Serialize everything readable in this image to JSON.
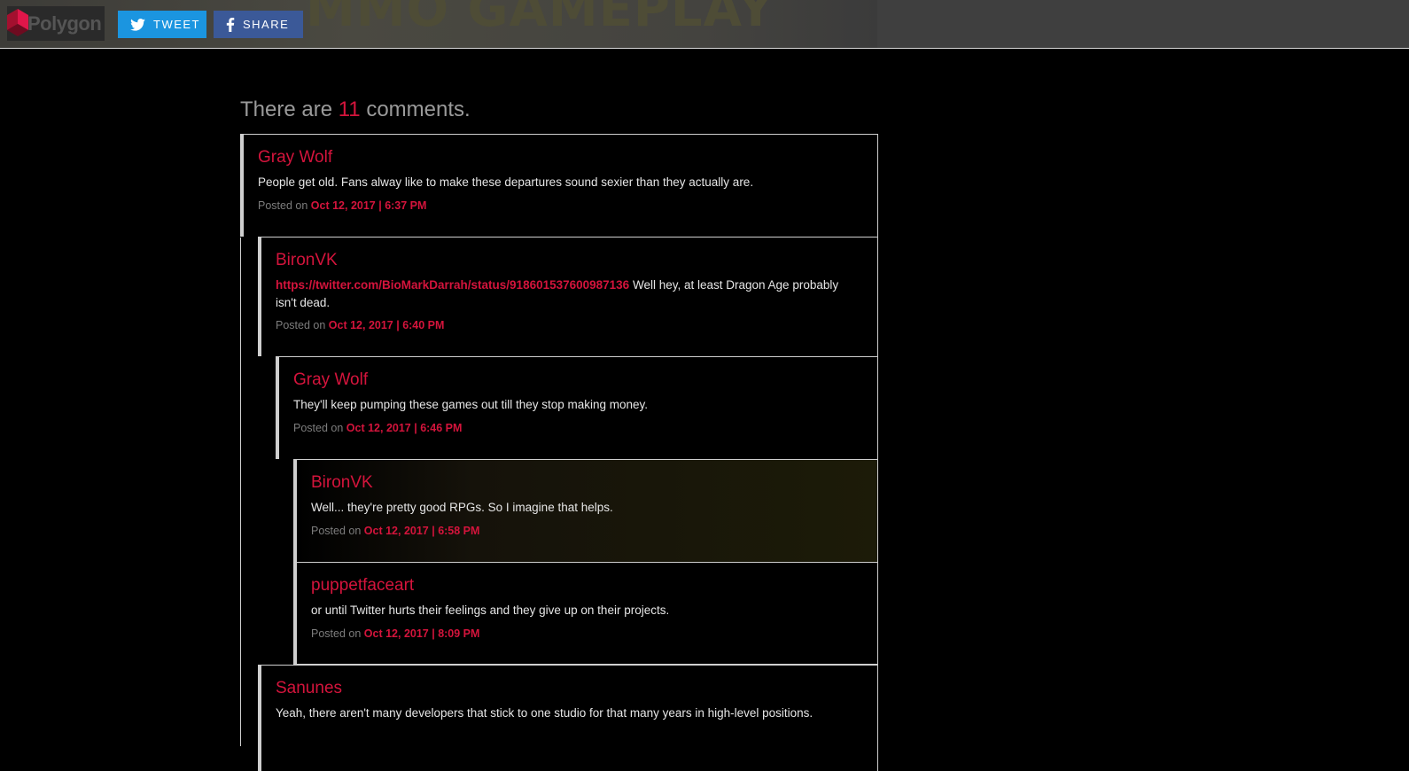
{
  "header": {
    "logo_text": "Polygon",
    "hero_text": "MMO GAMEPLAY",
    "tweet_label": "TWEET",
    "share_label": "SHARE",
    "colors": {
      "tweet": "#1b95e0",
      "facebook": "#3b5998",
      "accent": "#d4143c"
    }
  },
  "comments_heading": {
    "prefix": "There are",
    "count": "11",
    "suffix": "comments."
  },
  "comments": [
    {
      "author": "Gray Wolf",
      "text": "People get old. Fans alway like to make these departures sound sexier than they actually are.",
      "posted_label": "Posted on",
      "date": "Oct 12, 2017 | 6:37 PM"
    },
    {
      "author": "BironVK",
      "link": "https://twitter.com/BioMarkDarrah/status/918601537600987136",
      "text": "Well hey, at least Dragon Age probably isn't dead.",
      "posted_label": "Posted on",
      "date": "Oct 12, 2017 | 6:40 PM"
    },
    {
      "author": "Gray Wolf",
      "text": "They'll keep pumping these games out till they stop making money.",
      "posted_label": "Posted on",
      "date": "Oct 12, 2017 | 6:46 PM"
    },
    {
      "author": "BironVK",
      "text": "Well... they're pretty good RPGs. So I imagine that helps.",
      "posted_label": "Posted on",
      "date": "Oct 12, 2017 | 6:58 PM"
    },
    {
      "author": "puppetfaceart",
      "text": "or until Twitter hurts their feelings and they give up on their projects.",
      "posted_label": "Posted on",
      "date": "Oct 12, 2017 | 8:09 PM"
    },
    {
      "author": "Sanunes",
      "text": "Yeah, there aren't many developers that stick to one studio for that many years in high-level positions."
    }
  ]
}
